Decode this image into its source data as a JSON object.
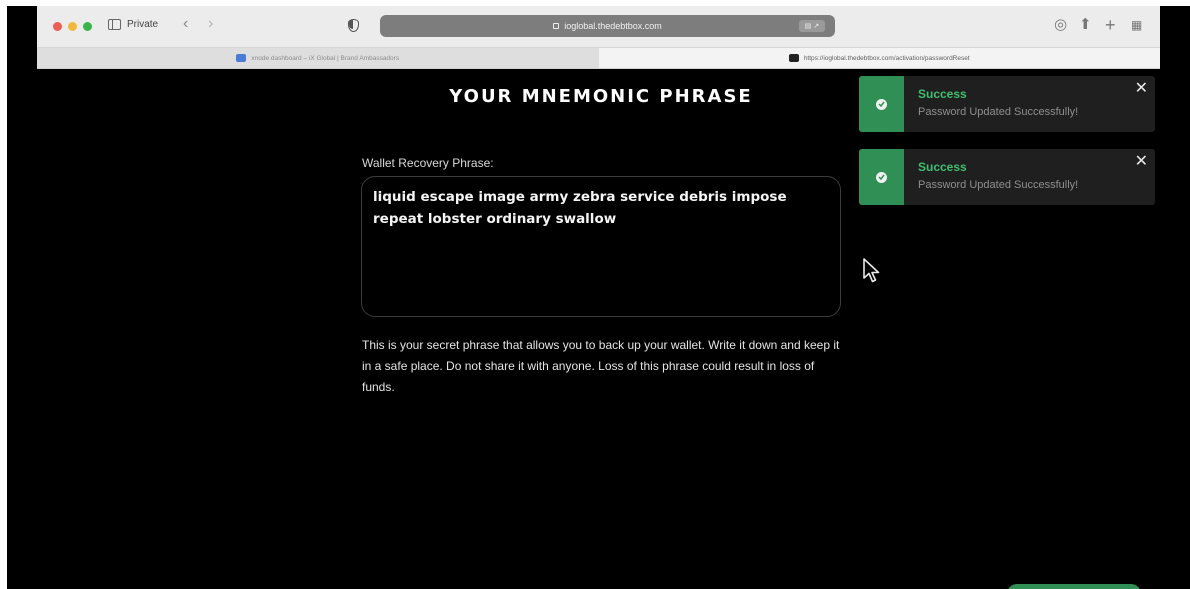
{
  "browser": {
    "private_label": "Private",
    "address": "ioglobal.thedebtbox.com",
    "address_badge": "▤ ↗",
    "tabs": [
      {
        "label": "xnode dashboard – iX Global | Brand Ambassadors",
        "icon_color": "#4a7bd6",
        "active": false
      },
      {
        "label": "https://ioglobal.thedebtbox.com/activation/passwordReset",
        "icon_color": "#222222",
        "active": true
      }
    ],
    "icons": [
      "back-icon",
      "forward-icon",
      "shield-icon",
      "download-icon",
      "share-icon",
      "new-tab-icon",
      "tab-overview-icon"
    ]
  },
  "page": {
    "title": "YOUR MNEMONIC PHRASE",
    "field_label": "Wallet Recovery Phrase:",
    "phrase_line1": "liquid escape image army zebra service debris impose",
    "phrase_line2": "repeat lobster ordinary swallow",
    "warning": "This is your secret phrase that allows you to back up your wallet. Write it down and keep it in a safe place. Do not share it with anyone. Loss of this phrase could result in loss of funds."
  },
  "toasts": [
    {
      "title": "Success",
      "message": "Password Updated Successfully!"
    },
    {
      "title": "Success",
      "message": "Password Updated Successfully!"
    }
  ],
  "colors": {
    "success": "#2f8f55",
    "success_text": "#3fbf6f",
    "background": "#000000"
  }
}
